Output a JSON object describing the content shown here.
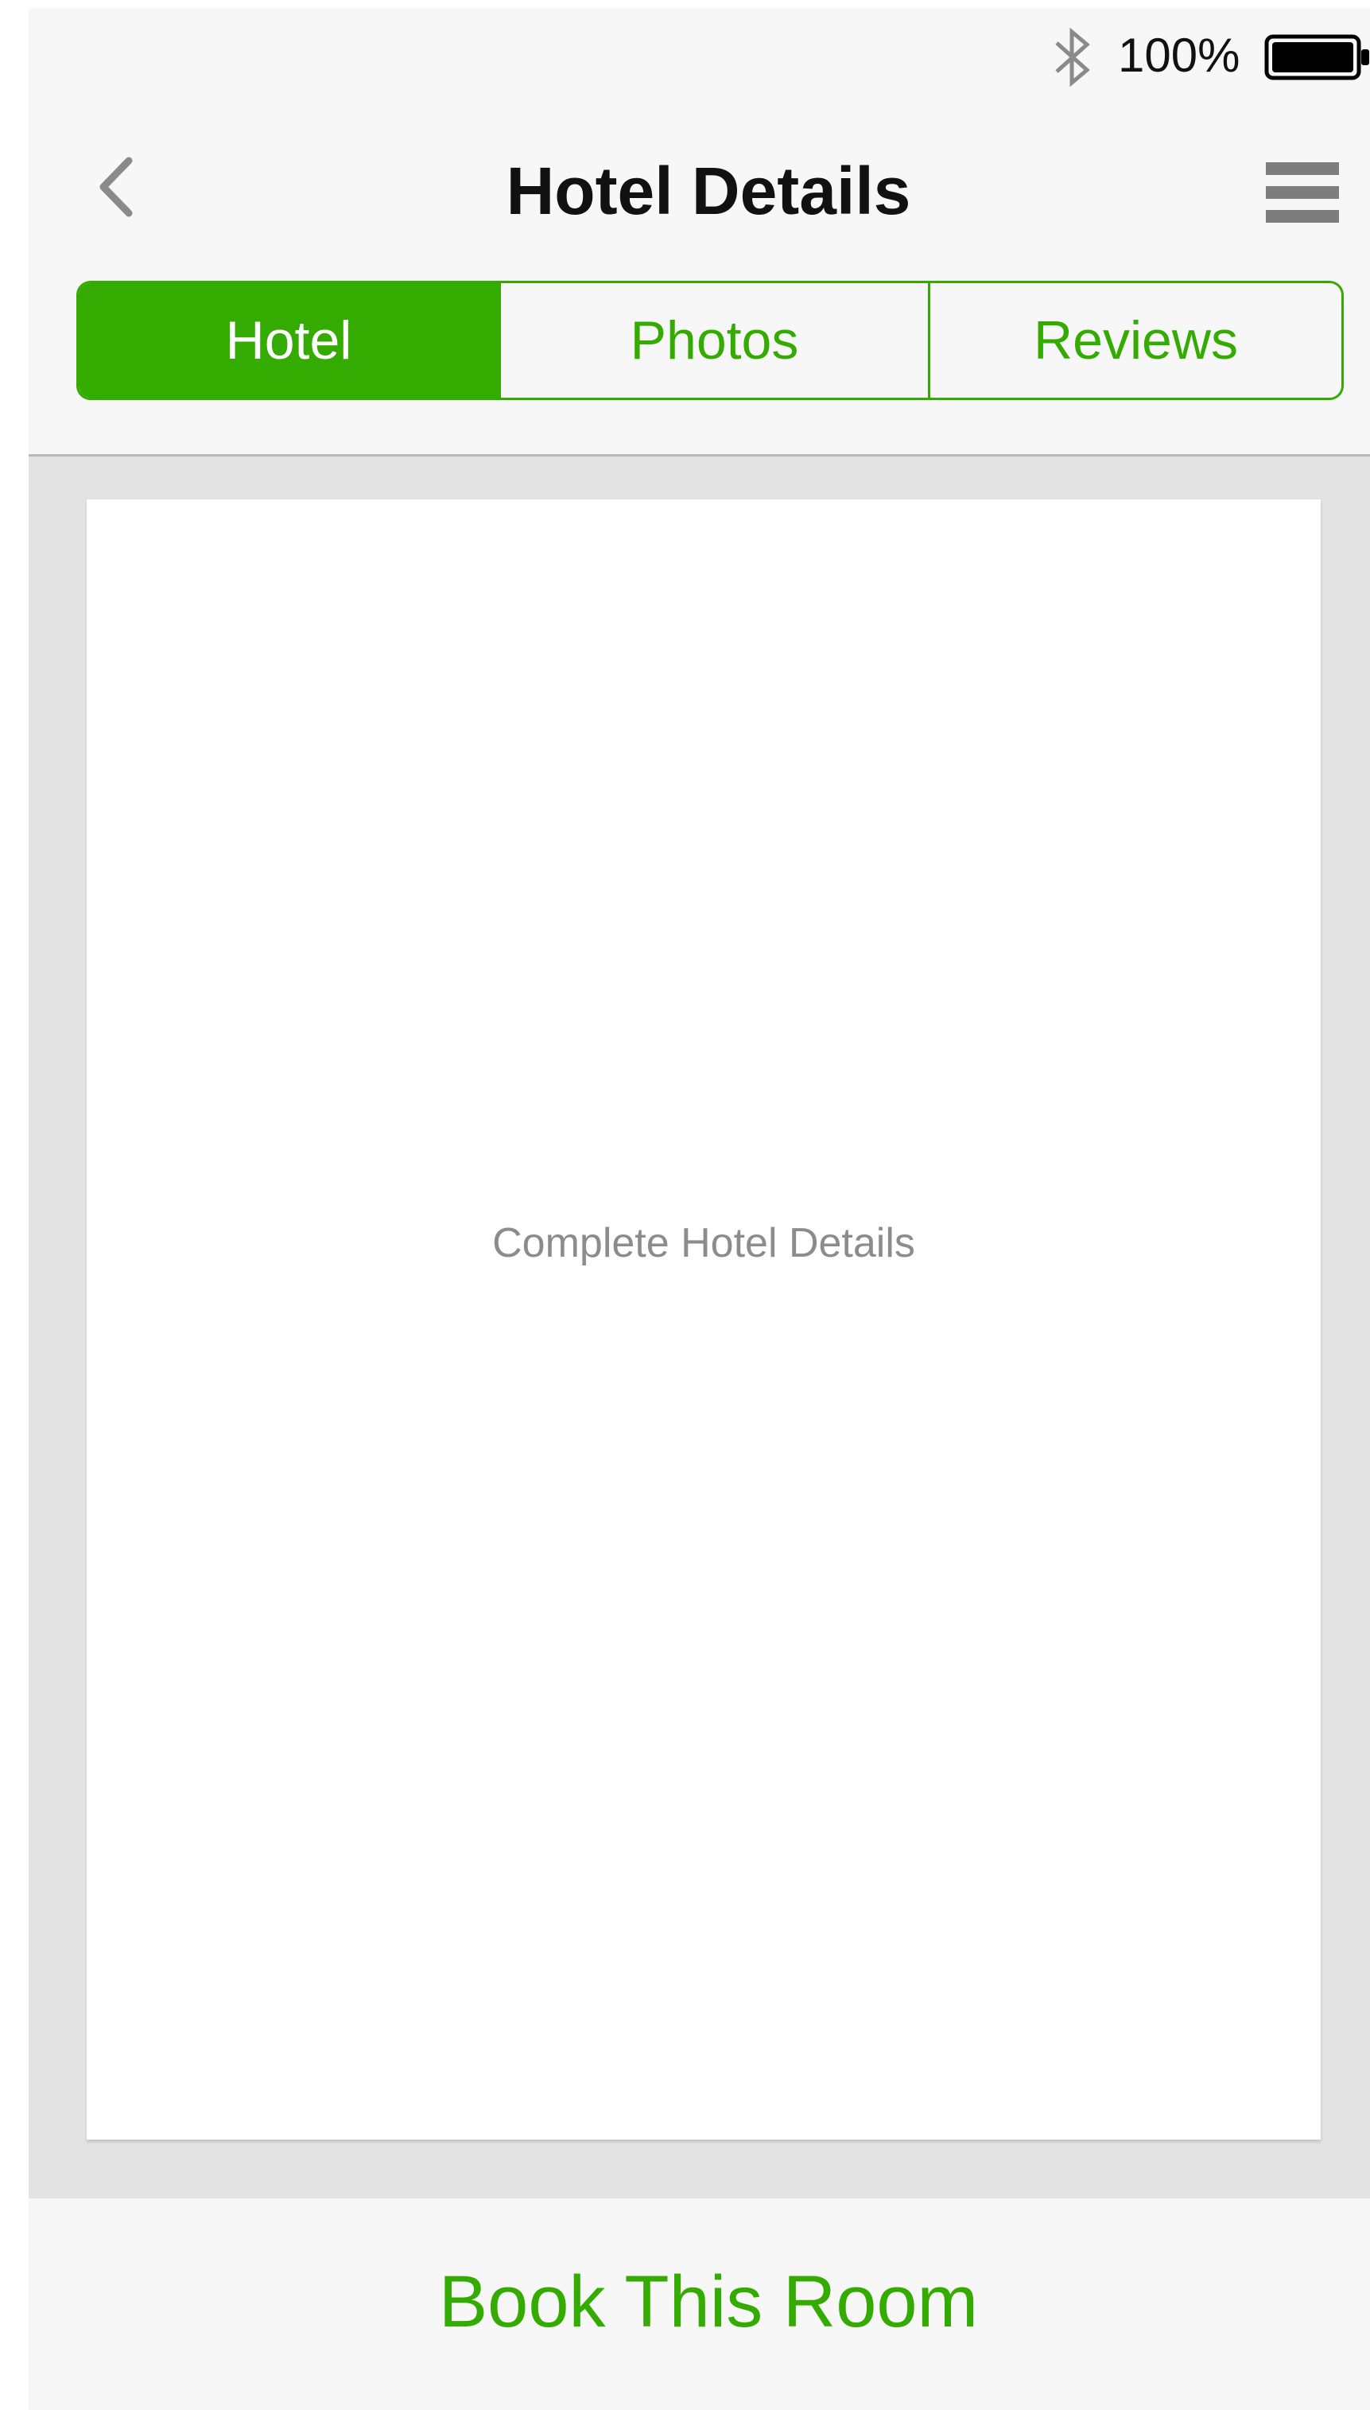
{
  "status_bar": {
    "bluetooth_icon": "bluetooth-icon",
    "battery_percent": "100%",
    "battery_icon": "battery-full-icon"
  },
  "nav_bar": {
    "back_icon": "chevron-left-icon",
    "title": "Hotel Details",
    "menu_icon": "hamburger-menu-icon"
  },
  "tabs": [
    {
      "label": "Hotel",
      "active": true
    },
    {
      "label": "Photos",
      "active": false
    },
    {
      "label": "Reviews",
      "active": false
    }
  ],
  "content": {
    "placeholder": "Complete Hotel Details"
  },
  "bottom_bar": {
    "book_label": "Book This Room"
  },
  "colors": {
    "accent": "#34ab00",
    "background": "#f7f7f7",
    "content_bg": "#e3e3e3",
    "card_bg": "#ffffff",
    "placeholder_text": "#8c8c8c"
  }
}
